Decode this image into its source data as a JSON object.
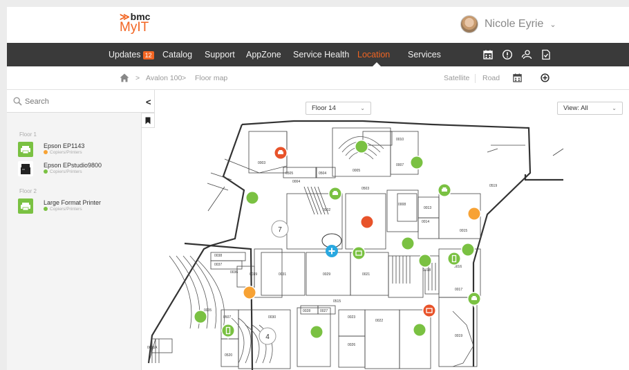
{
  "app": {
    "brand_line1": "bmc",
    "brand_line2": "MyIT"
  },
  "user": {
    "name": "Nicole Eyrie",
    "chevron": "⌄"
  },
  "nav": {
    "items": [
      {
        "label": "Updates",
        "badge": "12"
      },
      {
        "label": "Catalog"
      },
      {
        "label": "Support"
      },
      {
        "label": "AppZone"
      },
      {
        "label": "Service Health"
      },
      {
        "label": "Location",
        "active": true
      },
      {
        "label": "Services"
      }
    ],
    "icons": [
      "calendar-icon",
      "alert-icon",
      "people-icon",
      "document-check-icon"
    ]
  },
  "breadcrumb": {
    "home_icon": "home-icon",
    "items": [
      "Avalon 100",
      "Floor map"
    ],
    "separator": ">"
  },
  "map_views": {
    "satellite": "Satellite",
    "road": "Road"
  },
  "sidebar": {
    "search_placeholder": "Search",
    "collapse_icon": "<",
    "groups": [
      {
        "floor": "Floor 1",
        "items": [
          {
            "title": "Epson EP1143",
            "subtitle": "Copiers/Printers",
            "status_color": "#f7a234",
            "icon": "printer-icon"
          },
          {
            "title": "Epson EPstudio9800",
            "subtitle": "Copiers/Printers",
            "status_color": "#7ac142",
            "icon": "copier-icon"
          }
        ]
      },
      {
        "floor": "Floor 2",
        "items": [
          {
            "title": "Large Format Printer",
            "subtitle": "Copiers/Printers",
            "status_color": "#7ac142",
            "icon": "printer-icon"
          }
        ]
      }
    ]
  },
  "floor_select": {
    "value": "Floor 14"
  },
  "view_select": {
    "value": "View: All"
  },
  "floor_plan": {
    "room_numbers": [
      "0003",
      "0004",
      "0005",
      "0505",
      "0504",
      "0010",
      "0007",
      "0002",
      "0503",
      "0008",
      "0013",
      "0014",
      "0015",
      "0016",
      "0017",
      "0018",
      "0019",
      "0021",
      "0022",
      "0023",
      "0026",
      "0027",
      "0028",
      "0029",
      "0030",
      "0031",
      "0035",
      "0035A",
      "0036",
      "0037",
      "0038",
      "0039",
      "0507",
      "0515",
      "0520",
      "0519"
    ],
    "cluster_labels": [
      "7",
      "4"
    ]
  },
  "colors": {
    "brand_orange": "#f26522",
    "marker_green": "#7ac142",
    "marker_orange": "#f7a234",
    "marker_red": "#e8532a",
    "marker_blue": "#29a8e0",
    "nav_bg": "#3a3a3a"
  }
}
